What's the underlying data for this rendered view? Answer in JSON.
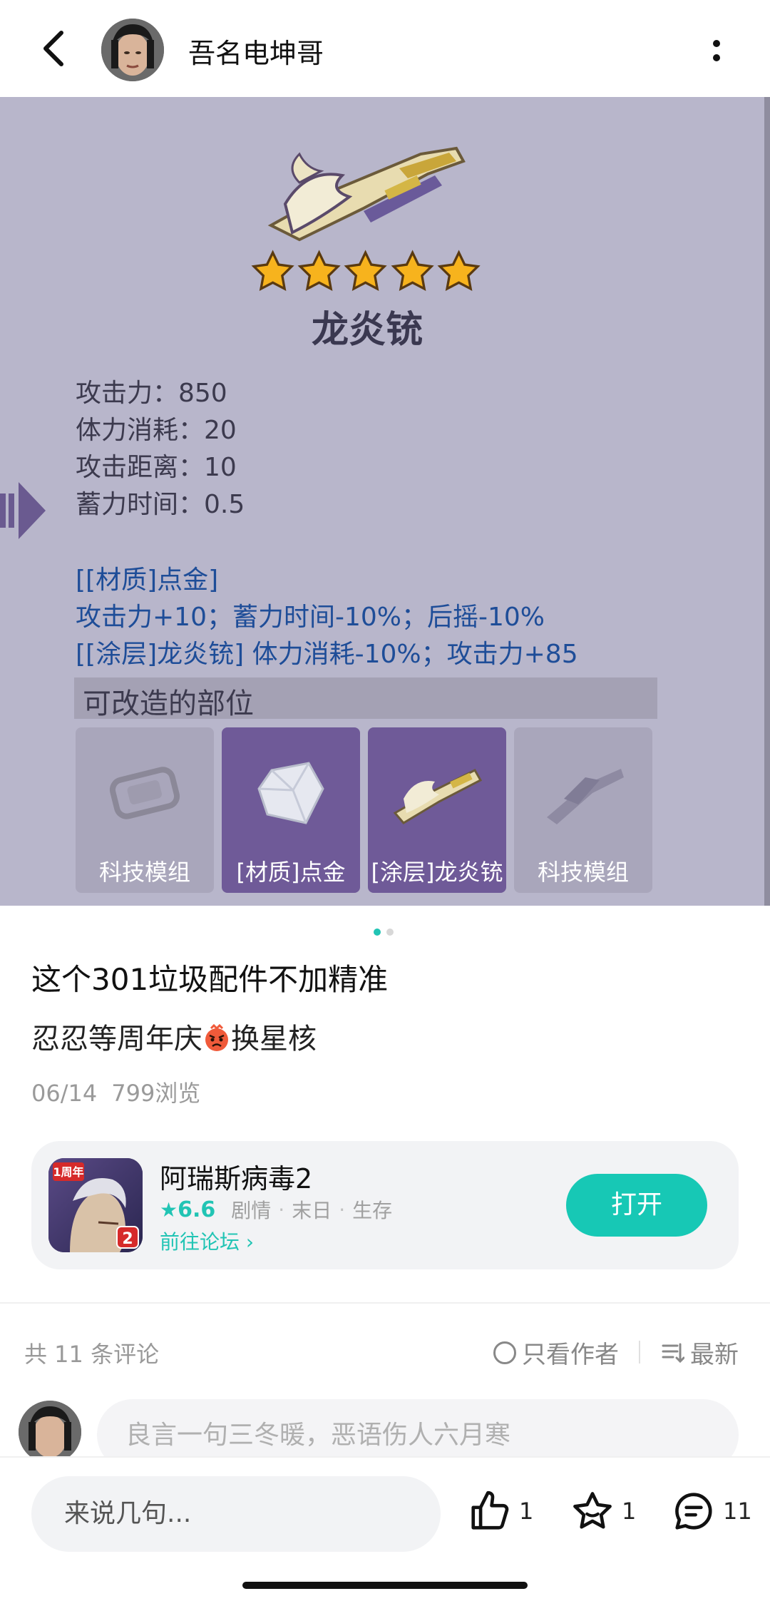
{
  "header": {
    "author_name": "吾名电坤哥",
    "back_icon": "chevron-left-icon",
    "more_icon": "more-vertical-icon"
  },
  "post_image": {
    "weapon_name": "龙炎铳",
    "stars": 5,
    "stats": [
      "攻击力：850",
      "体力消耗：20",
      "攻击距离：10",
      "蓄力时间：0.5"
    ],
    "mods": [
      "[[材质]点金]",
      "攻击力+10；蓄力时间-10%；后摇-10%",
      "[[涂层]龙炎铳] 体力消耗-10%；攻击力+85"
    ],
    "parts_title": "可改造的部位",
    "parts": [
      {
        "label": "科技模组"
      },
      {
        "label": "[材质]点金"
      },
      {
        "label": "[涂层]龙炎铳"
      },
      {
        "label": "科技模组"
      }
    ]
  },
  "pager": {
    "total": 2,
    "active": 1
  },
  "post": {
    "title": "这个301垃圾配件不加精准",
    "body_before": "忍忍等周年庆",
    "body_after": "换星核",
    "date": "06/14",
    "views": "799浏览"
  },
  "game_card": {
    "name": "阿瑞斯病毒2",
    "rating": "6.6",
    "tags": [
      "剧情",
      "末日",
      "生存"
    ],
    "forum_link": "前往论坛",
    "open_label": "打开",
    "badge_text": "1周年"
  },
  "comments": {
    "count_label": "共 11 条评论",
    "author_only": "只看作者",
    "sort_label": "最新",
    "input_placeholder": "良言一句三冬暖，恶语伤人六月寒"
  },
  "bottom_bar": {
    "reply_placeholder": "来说几句...",
    "like_count": "1",
    "fav_count": "1",
    "comment_count": "11"
  },
  "colors": {
    "accent": "#17c8b5",
    "image_bg": "#b8b6cb",
    "mod_text": "#1e4d98"
  }
}
